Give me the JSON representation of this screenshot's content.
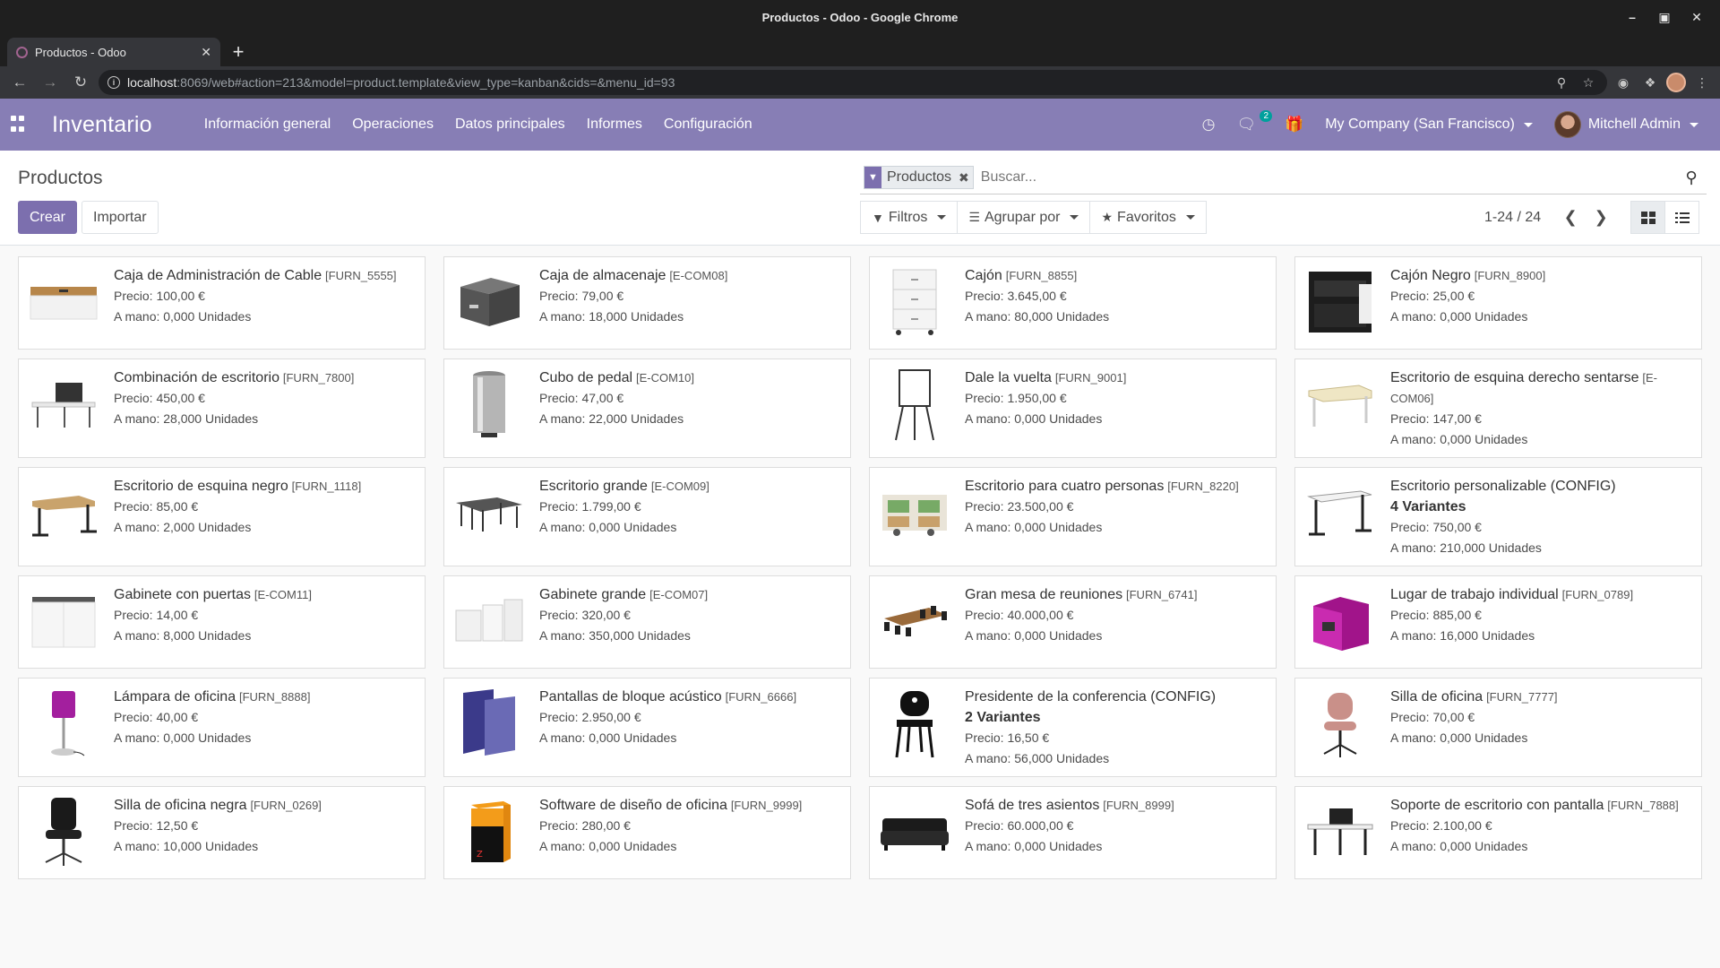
{
  "window": {
    "title": "Productos - Odoo - Google Chrome",
    "tab_title": "Productos - Odoo",
    "url_host": "localhost",
    "url_rest": ":8069/web#action=213&model=product.template&view_type=kanban&cids=&menu_id=93"
  },
  "navbar": {
    "app_name": "Inventario",
    "menus": [
      "Información general",
      "Operaciones",
      "Datos principales",
      "Informes",
      "Configuración"
    ],
    "messages_badge": "2",
    "company": "My Company (San Francisco)",
    "user": "Mitchell Admin"
  },
  "control_panel": {
    "breadcrumb": "Productos",
    "create_label": "Crear",
    "import_label": "Importar",
    "facet_label": "Productos",
    "search_placeholder": "Buscar...",
    "filters_label": "Filtros",
    "groupby_label": "Agrupar por",
    "favorites_label": "Favoritos",
    "pager_value": "1-24 / 24"
  },
  "products": [
    {
      "name": "Caja de Administración de Cable",
      "ref": "[FURN_5555]",
      "variants": "",
      "price": "Precio: 100,00 €",
      "onhand": "A mano: 0,000 Unidades",
      "icon": "cable-box"
    },
    {
      "name": "Caja de almacenaje",
      "ref": "[E-COM08]",
      "variants": "",
      "price": "Precio: 79,00 €",
      "onhand": "A mano: 18,000 Unidades",
      "icon": "storage-box"
    },
    {
      "name": "Cajón",
      "ref": "[FURN_8855]",
      "variants": "",
      "price": "Precio: 3.645,00 €",
      "onhand": "A mano: 80,000 Unidades",
      "icon": "drawer-white"
    },
    {
      "name": "Cajón Negro",
      "ref": "[FURN_8900]",
      "variants": "",
      "price": "Precio: 25,00 €",
      "onhand": "A mano: 0,000 Unidades",
      "icon": "drawer-black"
    },
    {
      "name": "Combinación de escritorio",
      "ref": "[FURN_7800]",
      "variants": "",
      "price": "Precio: 450,00 €",
      "onhand": "A mano: 28,000 Unidades",
      "icon": "desk-combo"
    },
    {
      "name": "Cubo de pedal",
      "ref": "[E-COM10]",
      "variants": "",
      "price": "Precio: 47,00 €",
      "onhand": "A mano: 22,000 Unidades",
      "icon": "pedal-bin"
    },
    {
      "name": "Dale la vuelta",
      "ref": "[FURN_9001]",
      "variants": "",
      "price": "Precio: 1.950,00 €",
      "onhand": "A mano: 0,000 Unidades",
      "icon": "flipchart"
    },
    {
      "name": "Escritorio de esquina derecho sentarse",
      "ref": "[E-COM06]",
      "variants": "",
      "price": "Precio: 147,00 €",
      "onhand": "A mano: 0,000 Unidades",
      "icon": "corner-desk-light"
    },
    {
      "name": "Escritorio de esquina negro",
      "ref": "[FURN_1118]",
      "variants": "",
      "price": "Precio: 85,00 €",
      "onhand": "A mano: 2,000 Unidades",
      "icon": "corner-desk-black"
    },
    {
      "name": "Escritorio grande",
      "ref": "[E-COM09]",
      "variants": "",
      "price": "Precio: 1.799,00 €",
      "onhand": "A mano: 0,000 Unidades",
      "icon": "large-desk"
    },
    {
      "name": "Escritorio para cuatro personas",
      "ref": "[FURN_8220]",
      "variants": "",
      "price": "Precio: 23.500,00 €",
      "onhand": "A mano: 0,000 Unidades",
      "icon": "four-person-desk"
    },
    {
      "name": "Escritorio personalizable (CONFIG)",
      "ref": "",
      "variants": "4 Variantes",
      "price": "Precio: 750,00 €",
      "onhand": "A mano: 210,000 Unidades",
      "icon": "custom-desk"
    },
    {
      "name": "Gabinete con puertas",
      "ref": "[E-COM11]",
      "variants": "",
      "price": "Precio: 14,00 €",
      "onhand": "A mano: 8,000 Unidades",
      "icon": "cabinet-doors"
    },
    {
      "name": "Gabinete grande",
      "ref": "[E-COM07]",
      "variants": "",
      "price": "Precio: 320,00 €",
      "onhand": "A mano: 350,000 Unidades",
      "icon": "large-cabinet"
    },
    {
      "name": "Gran mesa de reuniones",
      "ref": "[FURN_6741]",
      "variants": "",
      "price": "Precio: 40.000,00 €",
      "onhand": "A mano: 0,000 Unidades",
      "icon": "meeting-table"
    },
    {
      "name": "Lugar de trabajo individual",
      "ref": "[FURN_0789]",
      "variants": "",
      "price": "Precio: 885,00 €",
      "onhand": "A mano: 16,000 Unidades",
      "icon": "workstation-pod"
    },
    {
      "name": "Lámpara de oficina",
      "ref": "[FURN_8888]",
      "variants": "",
      "price": "Precio: 40,00 €",
      "onhand": "A mano: 0,000 Unidades",
      "icon": "office-lamp"
    },
    {
      "name": "Pantallas de bloque acústico",
      "ref": "[FURN_6666]",
      "variants": "",
      "price": "Precio: 2.950,00 €",
      "onhand": "A mano: 0,000 Unidades",
      "icon": "acoustic-screen"
    },
    {
      "name": "Presidente de la conferencia (CONFIG)",
      "ref": "",
      "variants": "2 Variantes",
      "price": "Precio: 16,50 €",
      "onhand": "A mano: 56,000 Unidades",
      "icon": "conference-chair"
    },
    {
      "name": "Silla de oficina",
      "ref": "[FURN_7777]",
      "variants": "",
      "price": "Precio: 70,00 €",
      "onhand": "A mano: 0,000 Unidades",
      "icon": "office-chair"
    },
    {
      "name": "Silla de oficina negra",
      "ref": "[FURN_0269]",
      "variants": "",
      "price": "Precio: 12,50 €",
      "onhand": "A mano: 10,000 Unidades",
      "icon": "black-office-chair"
    },
    {
      "name": "Software de diseño de oficina",
      "ref": "[FURN_9999]",
      "variants": "",
      "price": "Precio: 280,00 €",
      "onhand": "A mano: 0,000 Unidades",
      "icon": "software-box"
    },
    {
      "name": "Sofá de tres asientos",
      "ref": "[FURN_8999]",
      "variants": "",
      "price": "Precio: 60.000,00 €",
      "onhand": "A mano: 0,000 Unidades",
      "icon": "sofa"
    },
    {
      "name": "Soporte de escritorio con pantalla",
      "ref": "[FURN_7888]",
      "variants": "",
      "price": "Precio: 2.100,00 €",
      "onhand": "A mano: 0,000 Unidades",
      "icon": "desk-with-screen"
    }
  ],
  "colors": {
    "navbar": "#877eb5",
    "primary": "#7c6fae",
    "badge": "#00a09d"
  }
}
